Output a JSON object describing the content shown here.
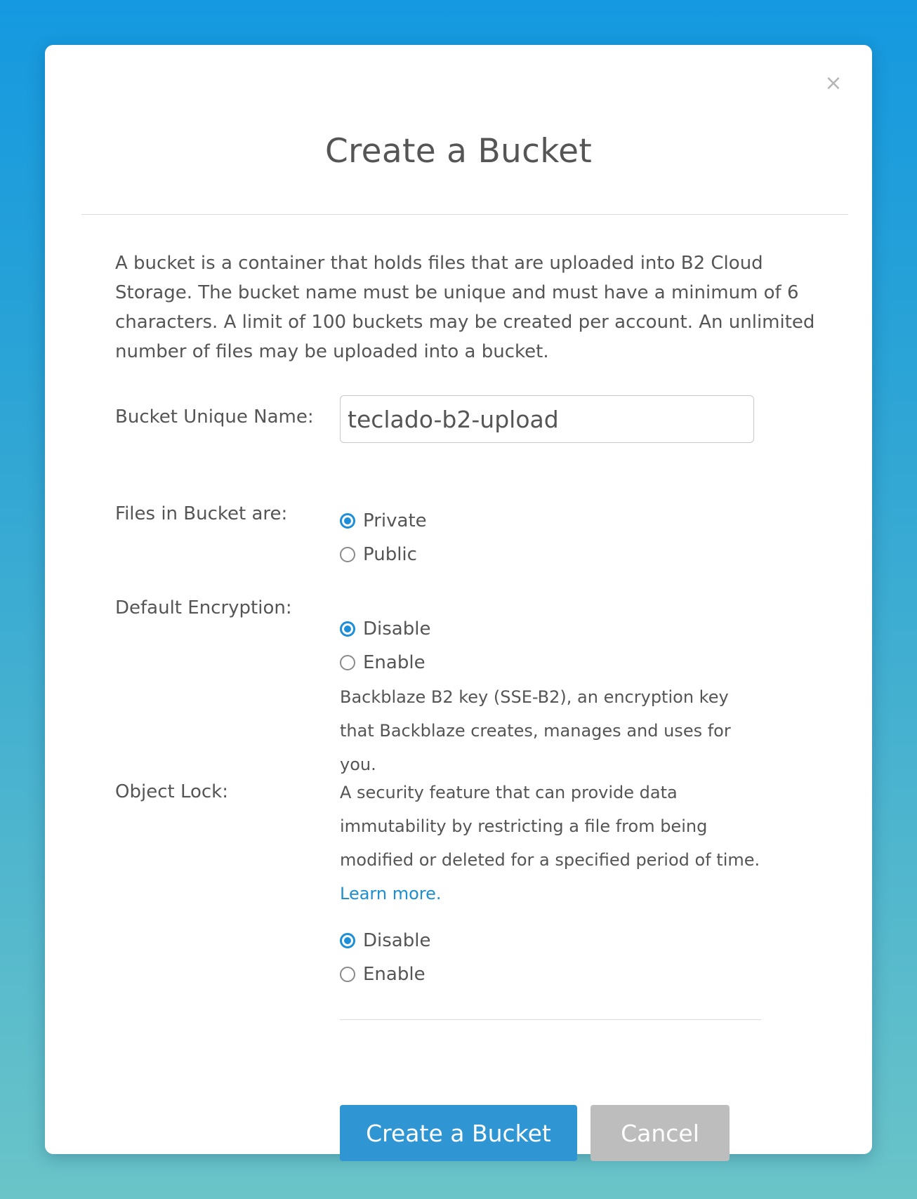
{
  "modal": {
    "title": "Create a Bucket",
    "close_glyph": "×",
    "intro": "A bucket is a container that holds files that are uploaded into B2 Cloud Storage. The bucket name must be unique and must have a minimum of 6 characters. A limit of 100 buckets may be created per account. An unlimited number of files may be uploaded into a bucket."
  },
  "bucket_name": {
    "label": "Bucket Unique Name:",
    "value": "teclado-b2-upload"
  },
  "files_visibility": {
    "label": "Files in Bucket are:",
    "options": [
      {
        "label": "Private",
        "checked": true
      },
      {
        "label": "Public",
        "checked": false
      }
    ]
  },
  "encryption": {
    "label": "Default Encryption:",
    "options": [
      {
        "label": "Disable",
        "checked": true
      },
      {
        "label": "Enable",
        "checked": false
      }
    ],
    "help": "Backblaze B2 key (SSE-B2), an encryption key that Backblaze creates, manages and uses for you."
  },
  "object_lock": {
    "label": "Object Lock:",
    "help": "A security feature that can provide data immutability by restricting a file from being modified or deleted for a specified period of time.",
    "learn_more": "Learn more.",
    "options": [
      {
        "label": "Disable",
        "checked": true
      },
      {
        "label": "Enable",
        "checked": false
      }
    ]
  },
  "actions": {
    "create_label": "Create a Bucket",
    "cancel_label": "Cancel"
  },
  "colors": {
    "accent": "#1d8fd8",
    "primary_button": "#2f95d3",
    "cancel_button": "#bdbdbd",
    "link": "#1d8fcf"
  }
}
